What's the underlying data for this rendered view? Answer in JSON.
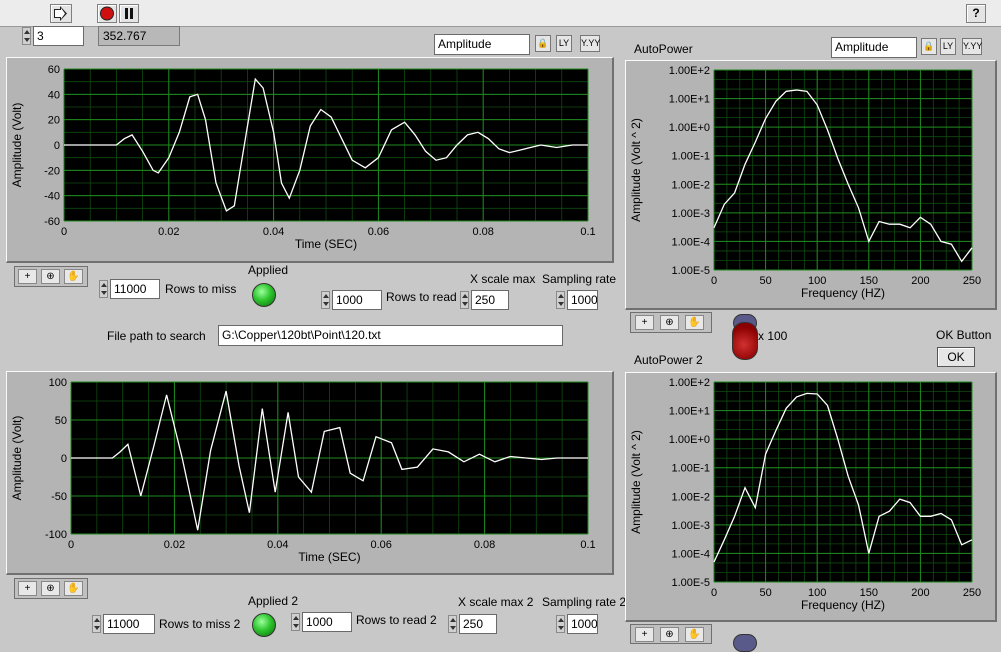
{
  "toolbar": {
    "run_icon": "run-arrow-icon",
    "stop_icon": "stop-icon",
    "pause_icon": "pause-icon",
    "help_label": "?"
  },
  "top_controls": {
    "index_value": "3",
    "readout_value": "352.767"
  },
  "graph_top": {
    "selector_label": "Amplitude",
    "xlabel": "Time (SEC)",
    "ylabel": "Amplitude (Volt)"
  },
  "graph_bottom": {
    "xlabel": "Time (SEC)",
    "ylabel": "Amplitude (Volt)"
  },
  "autopower1": {
    "title": "AutoPower",
    "selector_label": "Amplitude",
    "xlabel": "Frequency (HZ)",
    "ylabel": "Amplitude (Volt ^ 2)"
  },
  "autopower2": {
    "title": "AutoPower 2",
    "xlabel": "Frequency (HZ)",
    "ylabel": "Amplitude (Volt ^ 2)"
  },
  "controls1": {
    "rows_to_miss_value": "11000",
    "rows_to_miss_label": "Rows to miss",
    "applied_label": "Applied",
    "rows_to_read_value": "1000",
    "rows_to_read_label": "Rows to read",
    "xscale_label": "X scale max",
    "xscale_value": "250",
    "sampling_label": "Sampling rate",
    "sampling_value": "1000"
  },
  "file_path": {
    "label": "File path to search",
    "value": "G:\\Copper\\120bt\\Point\\120.txt"
  },
  "knob": {
    "label": "x 100"
  },
  "ok_button": {
    "caption": "OK Button",
    "label": "OK"
  },
  "controls2": {
    "rows_to_miss_value": "11000",
    "rows_to_miss_label": "Rows to miss 2",
    "applied_label": "Applied 2",
    "rows_to_read_value": "1000",
    "rows_to_read_label": "Rows to read 2",
    "xscale_label": "X scale max 2",
    "xscale_value": "250",
    "sampling_label": "Sampling rate 2",
    "sampling_value": "1000"
  },
  "colors": {
    "plot_bg": "#000000",
    "grid": "#1f8a1f",
    "trace": "#ffffff",
    "led_on": "#2ec62e",
    "knob": "#b01818"
  },
  "chart_data": [
    {
      "type": "line",
      "xlabel": "Time (SEC)",
      "ylabel": "Amplitude (Volt)",
      "xlim": [
        0,
        0.1
      ],
      "ylim": [
        -60,
        60
      ],
      "xticks": [
        "0",
        "0.02",
        "0.04",
        "0.06",
        "0.08",
        "0.1"
      ],
      "yticks": [
        "60",
        "40",
        "20",
        "0",
        "-20",
        "-40",
        "-60"
      ],
      "grid": true,
      "series": [
        {
          "x": [
            0,
            0.005,
            0.008,
            0.01,
            0.0115,
            0.013,
            0.015,
            0.017,
            0.018,
            0.02,
            0.022,
            0.024,
            0.0255,
            0.027,
            0.029,
            0.031,
            0.0325,
            0.034,
            0.0365,
            0.038,
            0.04,
            0.0415,
            0.043,
            0.045,
            0.047,
            0.049,
            0.051,
            0.053,
            0.055,
            0.0575,
            0.06,
            0.0625,
            0.065,
            0.067,
            0.069,
            0.071,
            0.073,
            0.075,
            0.077,
            0.079,
            0.081,
            0.083,
            0.085,
            0.087,
            0.089,
            0.091,
            0.094,
            0.097,
            0.1
          ],
          "y": [
            0,
            0,
            0,
            0,
            5,
            8,
            -5,
            -20,
            -22,
            -10,
            10,
            38,
            40,
            20,
            -30,
            -52,
            -48,
            -10,
            52,
            45,
            10,
            -30,
            -42,
            -20,
            15,
            28,
            22,
            5,
            -12,
            -18,
            -10,
            12,
            18,
            8,
            -5,
            -12,
            -10,
            0,
            8,
            10,
            5,
            -3,
            -6,
            -4,
            -2,
            0,
            -2,
            0,
            0
          ]
        }
      ]
    },
    {
      "type": "line",
      "title": "AutoPower",
      "xlabel": "Frequency (HZ)",
      "ylabel": "Amplitude (Volt ^ 2)",
      "xlim": [
        0,
        250
      ],
      "ylim": [
        1e-05,
        100
      ],
      "scale_y": "log",
      "xticks": [
        "0",
        "50",
        "100",
        "150",
        "200",
        "250"
      ],
      "yticks": [
        "1.00E+2",
        "1.00E+1",
        "1.00E+0",
        "1.00E-1",
        "1.00E-2",
        "1.00E-3",
        "1.00E-4",
        "1.00E-5"
      ],
      "grid": true,
      "series": [
        {
          "x": [
            0,
            10,
            20,
            30,
            40,
            50,
            60,
            70,
            80,
            90,
            100,
            110,
            120,
            130,
            140,
            150,
            160,
            170,
            180,
            190,
            200,
            210,
            220,
            230,
            240,
            250
          ],
          "y": [
            0.0003,
            0.002,
            0.005,
            0.05,
            0.3,
            2,
            8,
            18,
            20,
            18,
            6,
            0.8,
            0.08,
            0.01,
            0.0015,
            0.0001,
            0.0005,
            0.0004,
            0.0004,
            0.0003,
            0.0007,
            0.0004,
            0.0001,
            8e-05,
            2e-05,
            6e-05
          ]
        }
      ]
    },
    {
      "type": "line",
      "xlabel": "Time (SEC)",
      "ylabel": "Amplitude (Volt)",
      "xlim": [
        0,
        0.1
      ],
      "ylim": [
        -100,
        100
      ],
      "xticks": [
        "0",
        "0.02",
        "0.04",
        "0.06",
        "0.08",
        "0.1"
      ],
      "yticks": [
        "100",
        "50",
        "0",
        "-50",
        "-100"
      ],
      "grid": true,
      "series": [
        {
          "x": [
            0,
            0.005,
            0.008,
            0.0095,
            0.011,
            0.0135,
            0.016,
            0.0185,
            0.0215,
            0.0245,
            0.027,
            0.03,
            0.0325,
            0.0345,
            0.037,
            0.0395,
            0.042,
            0.044,
            0.0465,
            0.049,
            0.052,
            0.054,
            0.0565,
            0.059,
            0.062,
            0.064,
            0.067,
            0.07,
            0.073,
            0.076,
            0.079,
            0.082,
            0.085,
            0.088,
            0.091,
            0.094,
            0.097,
            0.1
          ],
          "y": [
            0,
            0,
            0,
            8,
            18,
            -50,
            15,
            83,
            0,
            -95,
            10,
            88,
            -10,
            -72,
            65,
            -45,
            60,
            -25,
            -45,
            35,
            40,
            -20,
            -30,
            28,
            20,
            -15,
            -12,
            12,
            8,
            -5,
            5,
            -5,
            2,
            0,
            -2,
            0,
            0,
            0
          ]
        }
      ]
    },
    {
      "type": "line",
      "title": "AutoPower 2",
      "xlabel": "Frequency (HZ)",
      "ylabel": "Amplitude (Volt ^ 2)",
      "xlim": [
        0,
        250
      ],
      "ylim": [
        1e-05,
        100
      ],
      "scale_y": "log",
      "xticks": [
        "0",
        "50",
        "100",
        "150",
        "200",
        "250"
      ],
      "yticks": [
        "1.00E+2",
        "1.00E+1",
        "1.00E+0",
        "1.00E-1",
        "1.00E-2",
        "1.00E-3",
        "1.00E-4",
        "1.00E-5"
      ],
      "grid": true,
      "series": [
        {
          "x": [
            0,
            10,
            20,
            30,
            40,
            50,
            60,
            70,
            80,
            90,
            100,
            110,
            120,
            130,
            140,
            150,
            160,
            170,
            180,
            190,
            200,
            210,
            220,
            230,
            240,
            250
          ],
          "y": [
            5e-05,
            0.0003,
            0.002,
            0.02,
            0.004,
            0.3,
            2,
            12,
            30,
            40,
            38,
            15,
            1,
            0.05,
            0.005,
            0.0001,
            0.002,
            0.003,
            0.008,
            0.006,
            0.002,
            0.002,
            0.0025,
            0.0015,
            0.0002,
            0.0003
          ]
        }
      ]
    }
  ]
}
